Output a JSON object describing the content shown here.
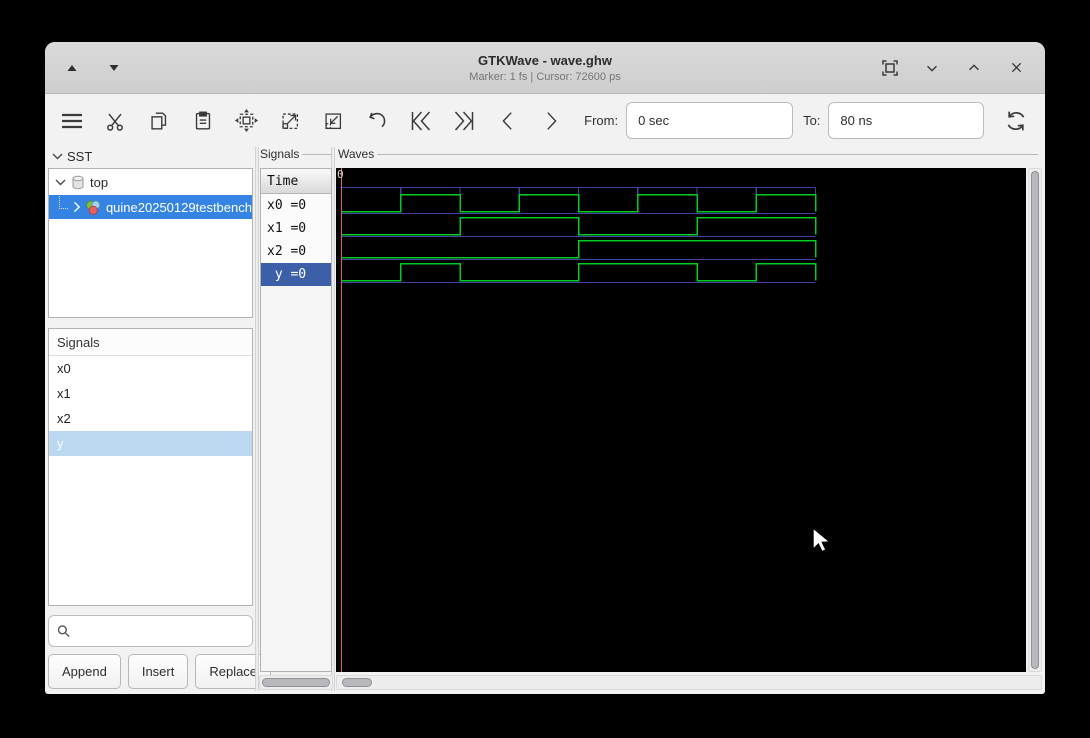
{
  "window": {
    "title": "GTKWave - wave.ghw",
    "subtitle": "Marker: 1 fs  |  Cursor: 72600 ps",
    "controls": [
      "shade-up",
      "shade-down",
      "tile",
      "minimize",
      "maximize",
      "close"
    ]
  },
  "toolbar": {
    "icons": [
      "menu",
      "cut",
      "copy",
      "paste",
      "zoom-fit",
      "zoom-in",
      "zoom-out",
      "undo",
      "go-first",
      "go-last",
      "go-previous",
      "go-next",
      "reload"
    ],
    "from_label": "From:",
    "from_value": "0 sec",
    "to_label": "To:",
    "to_value": "80 ns"
  },
  "sst": {
    "label": "SST",
    "items": [
      {
        "label": "top",
        "icon": "component-icon",
        "expanded": true
      },
      {
        "label": "quine20250129testbench",
        "icon": "module-icon",
        "selected": true
      }
    ]
  },
  "signals_list": {
    "header": "Signals",
    "items": [
      "x0",
      "x1",
      "x2",
      "y"
    ],
    "selected": "y"
  },
  "buttons": {
    "append": "Append",
    "insert": "Insert",
    "replace": "Replace"
  },
  "signals_column": {
    "frame_label": "Signals",
    "time_header": "Time",
    "rows": [
      {
        "text": "x0 =0",
        "selected": false
      },
      {
        "text": "x1 =0",
        "selected": false
      },
      {
        "text": "x2 =0",
        "selected": false
      },
      {
        "text": " y =0",
        "selected": true
      }
    ]
  },
  "waves": {
    "frame_label": "Waves",
    "origin_label": "0",
    "time_end_ns": 80,
    "tick_interval_ns": 10,
    "signals": [
      {
        "name": "x0",
        "transitions": [
          [
            0,
            0
          ],
          [
            10,
            1
          ],
          [
            20,
            0
          ],
          [
            30,
            1
          ],
          [
            40,
            0
          ],
          [
            50,
            1
          ],
          [
            60,
            0
          ],
          [
            70,
            1
          ]
        ]
      },
      {
        "name": "x1",
        "transitions": [
          [
            0,
            0
          ],
          [
            20,
            1
          ],
          [
            40,
            0
          ],
          [
            60,
            1
          ]
        ]
      },
      {
        "name": "x2",
        "transitions": [
          [
            0,
            0
          ],
          [
            40,
            1
          ]
        ]
      },
      {
        "name": "y",
        "transitions": [
          [
            0,
            0
          ],
          [
            10,
            1
          ],
          [
            20,
            0
          ],
          [
            40,
            1
          ],
          [
            60,
            0
          ],
          [
            70,
            1
          ]
        ]
      }
    ],
    "colors": {
      "trace": "#00cc22",
      "baseline": "#4343a6",
      "marker": "#e06060",
      "bg": "#000000"
    }
  },
  "accent_color": "#3584e4"
}
